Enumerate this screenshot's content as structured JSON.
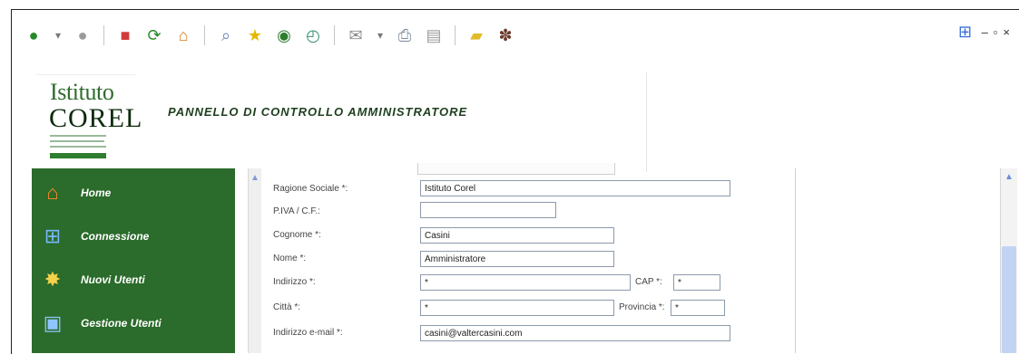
{
  "toolbar": {
    "icons": [
      "back-icon",
      "dropdown-arrow-icon",
      "forward-icon",
      "stop-icon",
      "refresh-icon",
      "home-icon",
      "search-icon",
      "favorites-icon",
      "media-icon",
      "history-icon",
      "mail-icon",
      "dropdown-arrow-icon",
      "print-icon",
      "edit-icon",
      "notes-icon",
      "extension-icon"
    ]
  },
  "window_controls": {
    "minimize": "–",
    "maximize": "▫",
    "close": "×"
  },
  "brand": {
    "line1": "Istituto",
    "line2": "COREL"
  },
  "header": {
    "title": "PANNELLO DI CONTROLLO AMMINISTRATORE"
  },
  "sidebar": {
    "items": [
      {
        "label": "Home",
        "icon": "house-icon"
      },
      {
        "label": "Connessione",
        "icon": "network-icon"
      },
      {
        "label": "Nuovi Utenti",
        "icon": "new-user-icon"
      },
      {
        "label": "Gestione Utenti",
        "icon": "computer-users-icon"
      }
    ]
  },
  "form": {
    "fields": [
      {
        "label": "Ragione Sociale *:",
        "value": ""
      },
      {
        "label": "P.IVA / C.F.:",
        "value": ""
      },
      {
        "label": "Cognome *:",
        "value": ""
      },
      {
        "label": "Nome *:",
        "value": ""
      },
      {
        "label": "Indirizzo *:",
        "value": "*"
      },
      {
        "label": "Città *:",
        "value": "*"
      },
      {
        "label": "Indirizzo e-mail *:",
        "value": ""
      }
    ],
    "values": {
      "ragione_sociale": "Istituto Corel",
      "piva": "",
      "cognome": "Casini",
      "nome": "Amministratore",
      "indirizzo": "*",
      "citta": "*",
      "email": "casini@valtercasini.com"
    },
    "cap_label": "CAP *:",
    "cap_value": "*",
    "provincia_label": "Provincia *:",
    "provincia_value": "*"
  }
}
